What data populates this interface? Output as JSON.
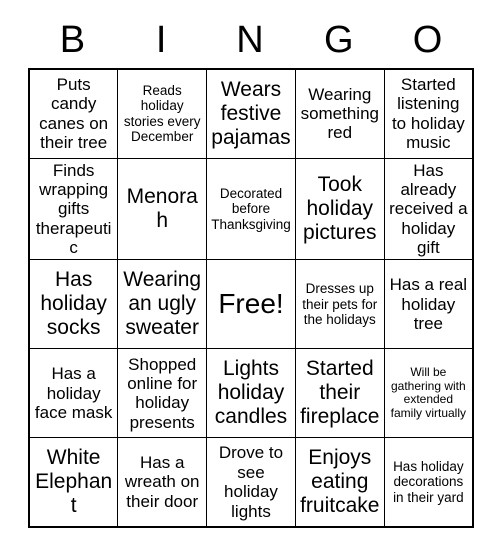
{
  "card": {
    "header_letters": [
      "B",
      "I",
      "N",
      "G",
      "O"
    ],
    "rows": [
      [
        {
          "text": "Puts candy canes on their tree",
          "size": "md"
        },
        {
          "text": "Reads holiday stories every December",
          "size": "sm"
        },
        {
          "text": "Wears festive pajamas",
          "size": "lg"
        },
        {
          "text": "Wearing something red",
          "size": "md"
        },
        {
          "text": "Started listening to holiday music",
          "size": "md"
        }
      ],
      [
        {
          "text": "Finds wrapping gifts therapeutic",
          "size": "md"
        },
        {
          "text": "Menorah",
          "size": "lg"
        },
        {
          "text": "Decorated before Thanksgiving",
          "size": "sm"
        },
        {
          "text": "Took holiday pictures",
          "size": "lg"
        },
        {
          "text": "Has already received a holiday gift",
          "size": "md"
        }
      ],
      [
        {
          "text": "Has holiday socks",
          "size": "lg"
        },
        {
          "text": "Wearing an ugly sweater",
          "size": "lg"
        },
        {
          "text": "Free!",
          "size": "xl"
        },
        {
          "text": "Dresses up their pets for the holidays",
          "size": "sm"
        },
        {
          "text": "Has a real holiday tree",
          "size": "md"
        }
      ],
      [
        {
          "text": "Has a holiday face mask",
          "size": "md"
        },
        {
          "text": "Shopped online for holiday presents",
          "size": "md"
        },
        {
          "text": "Lights holiday candles",
          "size": "lg"
        },
        {
          "text": "Started their fireplace",
          "size": "lg"
        },
        {
          "text": "Will be gathering with extended family virtually",
          "size": "xs"
        }
      ],
      [
        {
          "text": "White Elephant",
          "size": "lg"
        },
        {
          "text": "Has a wreath on their door",
          "size": "md"
        },
        {
          "text": "Drove to see holiday lights",
          "size": "md"
        },
        {
          "text": "Enjoys eating fruitcake",
          "size": "lg"
        },
        {
          "text": "Has holiday decorations in their yard",
          "size": "sm"
        }
      ]
    ]
  }
}
